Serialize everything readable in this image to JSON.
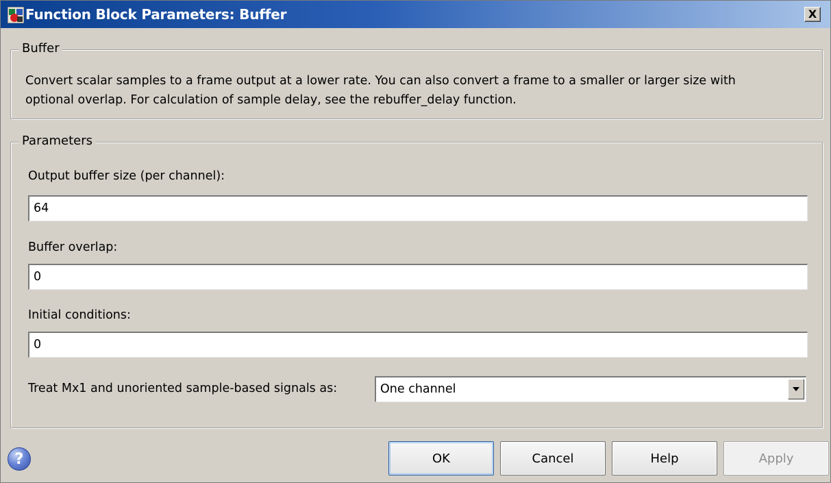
{
  "window": {
    "title": "Function Block Parameters: Buffer",
    "close_label": "X",
    "title_gradient": [
      "#0b3f8f",
      "#a9c4e8"
    ]
  },
  "buffer_group": {
    "legend": "Buffer",
    "description_line1": "Convert scalar samples to a frame output at a lower rate. You can also convert a frame to a smaller or larger size with",
    "description_line2": "optional overlap. For calculation of sample delay, see the rebuffer_delay function."
  },
  "parameters_group": {
    "legend": "Parameters",
    "output_buffer_size": {
      "label": "Output buffer size (per channel):",
      "value": "64"
    },
    "buffer_overlap": {
      "label": "Buffer overlap:",
      "value": "0"
    },
    "initial_conditions": {
      "label": "Initial conditions:",
      "value": "0"
    },
    "treat_signals": {
      "label": "Treat Mx1 and unoriented sample-based signals as:",
      "selected": "One channel"
    }
  },
  "footer": {
    "help_icon": "question-circle-icon",
    "help_glyph": "?",
    "ok_label": "OK",
    "cancel_label": "Cancel",
    "help_label": "Help",
    "apply_label": "Apply"
  }
}
